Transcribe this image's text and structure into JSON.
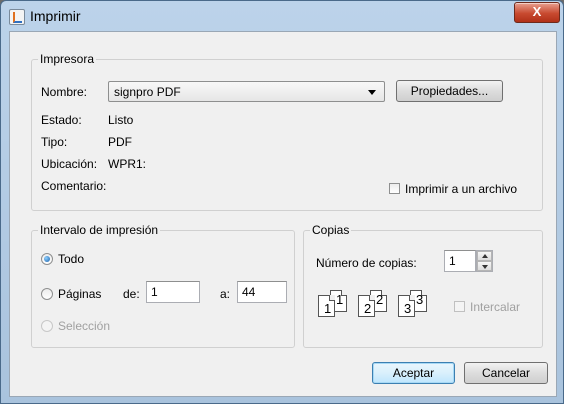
{
  "window": {
    "title": "Imprimir",
    "close_glyph": "X"
  },
  "printer": {
    "group_label": "Impresora",
    "name_label": "Nombre:",
    "name_value": "signpro PDF",
    "properties_button": "Propiedades...",
    "status_label": "Estado:",
    "status_value": "Listo",
    "type_label": "Tipo:",
    "type_value": "PDF",
    "location_label": "Ubicación:",
    "location_value": "WPR1:",
    "comment_label": "Comentario:",
    "print_to_file_label": "Imprimir a un archivo",
    "print_to_file_checked": false
  },
  "range": {
    "group_label": "Intervalo de impresión",
    "all_label": "Todo",
    "pages_label": "Páginas",
    "from_label": "de:",
    "from_value": "1",
    "to_label": "a:",
    "to_value": "44",
    "selection_label": "Selección",
    "selected": "all"
  },
  "copies": {
    "group_label": "Copias",
    "count_label": "Número de copias:",
    "count_value": "1",
    "collate_label": "Intercalar",
    "collate_checked": false,
    "collate_icon_numbers": [
      "1",
      "1",
      "2",
      "2",
      "3",
      "3"
    ]
  },
  "buttons": {
    "accept": "Aceptar",
    "cancel": "Cancelar"
  },
  "icons": {
    "app": "java-print-icon",
    "close": "close-icon",
    "dropdown": "chevron-down-icon",
    "spinner_up": "spin-up-icon",
    "spinner_down": "spin-down-icon",
    "collate": "collate-pages-icon"
  },
  "colors": {
    "titlebar": "#bcd3ea",
    "close_button": "#c84a30",
    "default_button": "#d9f0fc"
  }
}
